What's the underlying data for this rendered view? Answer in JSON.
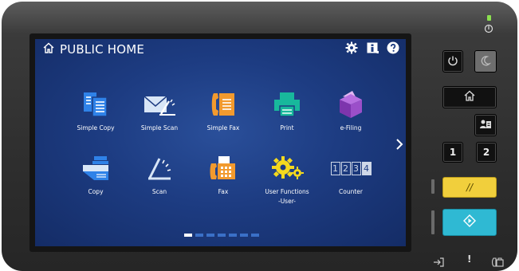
{
  "screen": {
    "title": "PUBLIC HOME",
    "top_icons": [
      "home-icon",
      "gear-icon",
      "info-icon",
      "help-icon"
    ]
  },
  "tiles_row1": [
    {
      "label": "Simple Copy",
      "icon": "simple-copy-icon"
    },
    {
      "label": "Simple Scan",
      "icon": "simple-scan-icon"
    },
    {
      "label": "Simple Fax",
      "icon": "simple-fax-icon"
    },
    {
      "label": "Print",
      "icon": "print-icon"
    },
    {
      "label": "e-Filing",
      "icon": "e-filing-icon"
    }
  ],
  "tiles_row2": [
    {
      "label": "Copy",
      "icon": "copy-icon"
    },
    {
      "label": "Scan",
      "icon": "scan-icon"
    },
    {
      "label": "Fax",
      "icon": "fax-icon"
    },
    {
      "label": "User Functions",
      "label2": "-User-",
      "icon": "user-functions-icon"
    },
    {
      "label": "Counter",
      "icon": "counter-icon",
      "glyph": "1234"
    }
  ],
  "pager": {
    "pages": 7,
    "active": 1
  },
  "panel": {
    "page_button_1": "1",
    "page_button_2": "2",
    "reset_glyph": "//",
    "bottom_icons": [
      "login-icon",
      "alert-icon",
      "fax-status-icon"
    ],
    "alert_glyph": "!"
  },
  "colors": {
    "screen_bg": "#1d3c82",
    "icon_blue": "#2f82e8",
    "icon_orange": "#f29a2e",
    "icon_teal": "#18b89c",
    "icon_purple": "#9b4fc9",
    "icon_yellow": "#f4d91e",
    "clear_button": "#f1cf3c",
    "start_button": "#2fb9d3",
    "status_led": "#8be04f"
  }
}
